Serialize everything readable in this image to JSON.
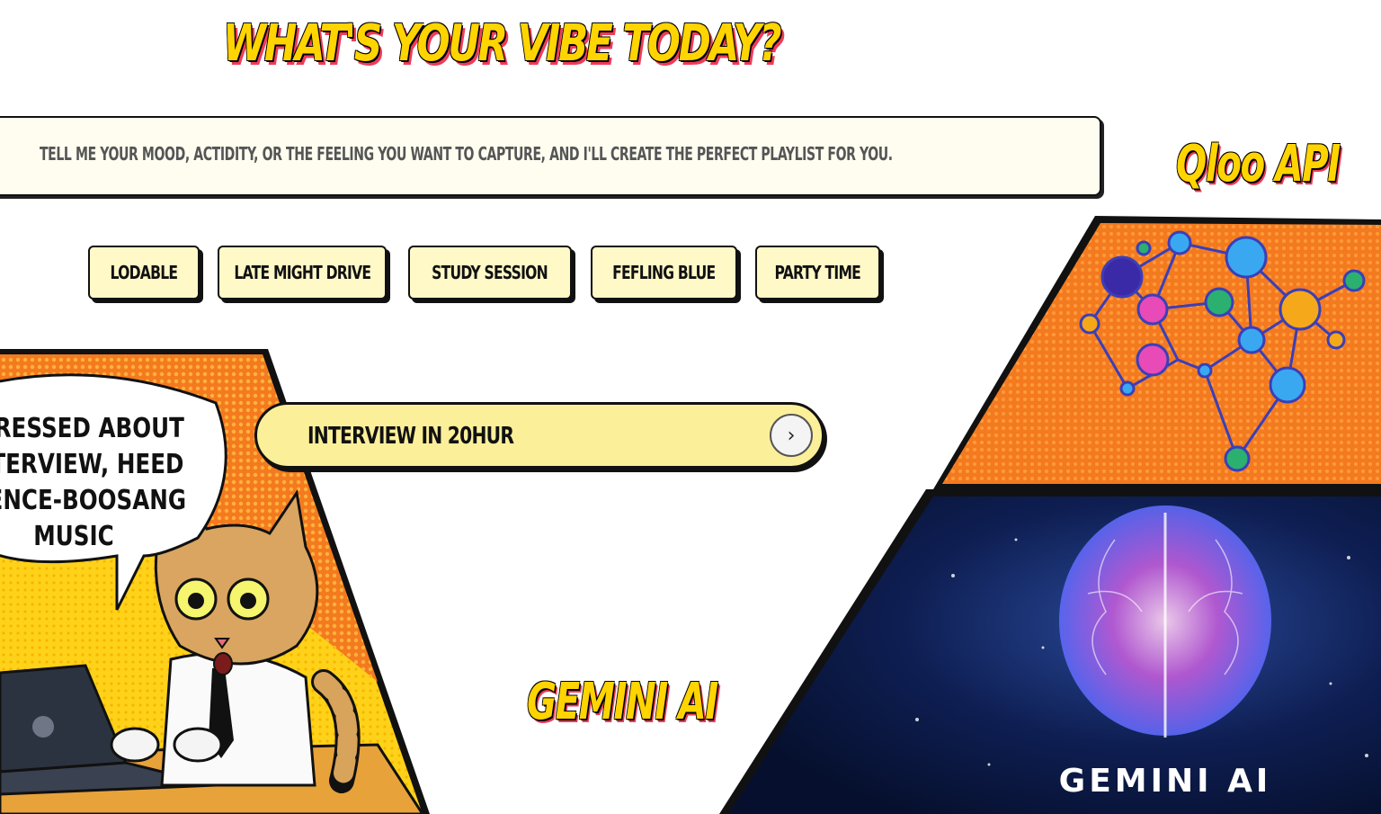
{
  "title": "WHAT'S YOUR VIBE TODAY?",
  "prompt": {
    "text": "TELL ME YOUR MOOD, ACTIDITY, OR THE FEELING YOU WANT TO CAPTURE, AND I'LL CREATE THE PERFECT PLAYLIST FOR YOU."
  },
  "chips": [
    {
      "label": "LODABLE"
    },
    {
      "label": "LATE MIGHT DRIVE"
    },
    {
      "label": "STUDY SESSION"
    },
    {
      "label": "FEFLING BLUE"
    },
    {
      "label": "PARTY TIME"
    }
  ],
  "comic": {
    "bubble_lines": [
      "STRESSED ABOUT",
      "INTERVIEW, HEED",
      "IDENCE-BOOSANG",
      "MUSIC"
    ]
  },
  "pill": {
    "text": "INTERVIEW IN 20HUR",
    "button_icon": "chevron-right-icon"
  },
  "labels": {
    "qloo": "Qloo API",
    "gemini": "GEMINI AI",
    "gemini_art": "GEMINI AI"
  },
  "colors": {
    "accent_yellow": "#ffd400",
    "shadow_red": "#ef3b5a",
    "orange": "#f47a1f",
    "navy": "#0b1a45"
  }
}
